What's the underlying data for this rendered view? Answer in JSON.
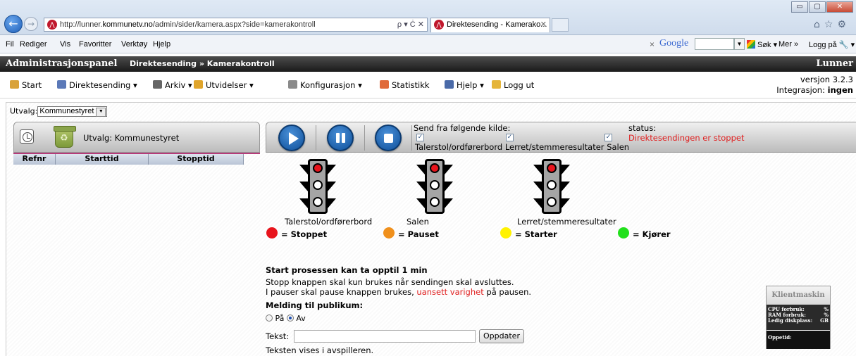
{
  "browser": {
    "url_prefix": "http://lunner.",
    "url_host": "kommunetv.no",
    "url_rest": "/admin/sider/kamera.aspx?side=kamerakontroll",
    "url_controls": "ρ ▾ Ċ ✕",
    "tab_title": "Direktesending - Kamerako...",
    "tab_close": "✕",
    "right_icons": "⌂☆⚙",
    "window_buttons": [
      "▭",
      "▢",
      "✕"
    ],
    "menu": [
      "Fil",
      "Rediger",
      "Vis",
      "Favoritter",
      "Verktøy",
      "Hjelp"
    ],
    "google_label": "Google",
    "search_label": "Søk ▾",
    "more_label": "Mer »",
    "login_label": "Logg på 🔧 ▾"
  },
  "admin": {
    "title": "Administrasjonspanel",
    "breadcrumb": "Direktesending » Kamerakontroll",
    "brand": "Lunner"
  },
  "toolbar": {
    "items": [
      {
        "label": "Start",
        "icon": "home-icon",
        "color": "#d9a23a"
      },
      {
        "label": "Direktesending ▾",
        "icon": "monitor-icon",
        "color": "#5b79b8"
      },
      {
        "label": "Arkiv ▾",
        "icon": "archive-icon",
        "color": "#666666"
      },
      {
        "label": "Utvidelser ▾",
        "icon": "puzzle-icon",
        "color": "#e0a52c"
      },
      {
        "label": "Konfigurasjon ▾",
        "icon": "gear-icon",
        "color": "#8a8a8a"
      },
      {
        "label": "Statistikk",
        "icon": "chart-icon",
        "color": "#e06a3a"
      },
      {
        "label": "Hjelp ▾",
        "icon": "help-icon",
        "color": "#4a6aa8"
      },
      {
        "label": "Logg ut",
        "icon": "lock-icon",
        "color": "#e5b53a"
      }
    ],
    "version": "versjon 3.2.3",
    "integration_label": "Integrasjon:",
    "integration_value": "ingen"
  },
  "selection": {
    "label": "Utvalg:",
    "value": "Kommunestyret",
    "panel_title": "Utvalg: Kommunestyret"
  },
  "table": {
    "columns": [
      "Refnr",
      "Starttid",
      "Stopptid"
    ]
  },
  "control": {
    "send_label": "Send fra følgende kilde:",
    "sources": [
      "Talerstol/ordførerbord",
      "Lerret/stemmeresultater",
      "Salen"
    ],
    "checkbox_mark": "✓",
    "status_label": "status:",
    "status_value": "Direktesendingen er stoppet"
  },
  "lights": [
    {
      "label": "Talerstol/ordførerbord"
    },
    {
      "label": "Salen"
    },
    {
      "label": "Lerret/stemmeresultater"
    }
  ],
  "legend": [
    {
      "label": "= Stoppet",
      "color": "#e8141c"
    },
    {
      "label": "= Pauset",
      "color": "#f0901c"
    },
    {
      "label": "= Starter",
      "color": "#fff200"
    },
    {
      "label": "= Kjører",
      "color": "#22e01c"
    }
  ],
  "info": {
    "heading": "Start prosessen kan ta opptil 1 min",
    "line1": "Stopp knappen skal kun brukes når sendingen skal avsluttes.",
    "line2_a": "I pauser skal pause knappen brukes, ",
    "line2_red": "uansett varighet",
    "line2_b": " på pausen.",
    "message_heading": "Melding til publikum:",
    "radio_on": "På",
    "radio_off": "Av",
    "text_label": "Tekst:",
    "text_value": "",
    "update_button": "Oppdater",
    "footer": "Teksten vises i avspilleren."
  },
  "client": {
    "title": "Klientmaskin",
    "cpu_label": "CPU forbruk:",
    "cpu_value": "%",
    "ram_label": "RAM forbruk:",
    "ram_value": "%",
    "disk_label": "Ledig diskplass:",
    "disk_value": "GB",
    "uptime_label": "Oppetid:"
  }
}
